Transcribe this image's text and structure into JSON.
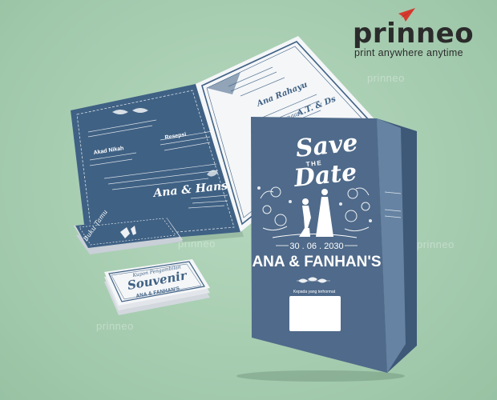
{
  "brand": {
    "name": "prinneo",
    "tagline": "print anywhere anytime",
    "accent_color": "#d63a2f"
  },
  "watermark_text": "prinneo",
  "main_card": {
    "title_line1": "Save",
    "title_line2": "THE",
    "title_line3": "Date",
    "date": "30 . 06 . 2030",
    "names": "ANA & FANHAN'S",
    "guest_caption": "Kepada yang terhormat",
    "card_color": "#4f6a8a"
  },
  "open_card": {
    "event1": "Akad Nikah",
    "event2": "Resepsi",
    "couple": "Ana & Hans",
    "bride_name": "Ana Rahayu",
    "connector": "Dengan",
    "groom_initials": "A.T. & Ds"
  },
  "souvenir_card": {
    "label": "Kupon Pengambilan",
    "title": "Souvenir",
    "names": "ANA & FANHAN'S"
  },
  "guest_card": {
    "label": "Buku Tamu"
  }
}
